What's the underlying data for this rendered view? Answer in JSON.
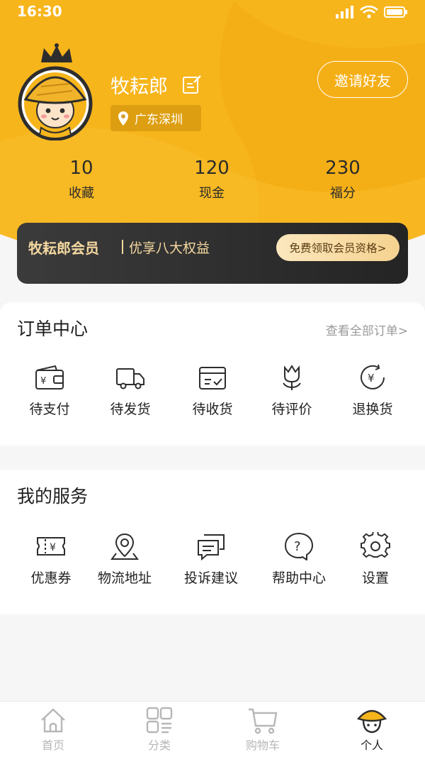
{
  "status_bar": {
    "time": "16:30"
  },
  "profile": {
    "name": "牧耘郎",
    "location": "广东深圳",
    "invite_label": "邀请好友"
  },
  "stats": [
    {
      "value": "10",
      "label": "收藏"
    },
    {
      "value": "120",
      "label": "现金"
    },
    {
      "value": "230",
      "label": "福分"
    }
  ],
  "member": {
    "title": "牧耘郎会员",
    "subtitle": "优享八大权益",
    "button": "免费领取会员资格>"
  },
  "orders": {
    "title": "订单中心",
    "view_all": "查看全部订单>",
    "items": [
      {
        "label": "待支付",
        "icon": "wallet-icon"
      },
      {
        "label": "待发货",
        "icon": "truck-icon"
      },
      {
        "label": "待收货",
        "icon": "box-check-icon"
      },
      {
        "label": "待评价",
        "icon": "tulip-icon"
      },
      {
        "label": "退换货",
        "icon": "refund-icon"
      }
    ]
  },
  "services": {
    "title": "我的服务",
    "items": [
      {
        "label": "优惠券",
        "icon": "coupon-icon"
      },
      {
        "label": "物流地址",
        "icon": "location-pin-icon"
      },
      {
        "label": "投诉建议",
        "icon": "chat-icon"
      },
      {
        "label": "帮助中心",
        "icon": "help-icon"
      },
      {
        "label": "设置",
        "icon": "gear-icon"
      }
    ]
  },
  "tabbar": {
    "items": [
      {
        "label": "首页",
        "icon": "home-icon",
        "active": false
      },
      {
        "label": "分类",
        "icon": "category-icon",
        "active": false
      },
      {
        "label": "购物车",
        "icon": "cart-icon",
        "active": false
      },
      {
        "label": "个人",
        "icon": "profile-hat-icon",
        "active": true
      }
    ]
  },
  "colors": {
    "header_yellow": "#f7b51c",
    "member_dark": "#2c2c2c",
    "member_gold": "#f5d9a0",
    "inactive_tab": "#b7b7b7"
  }
}
